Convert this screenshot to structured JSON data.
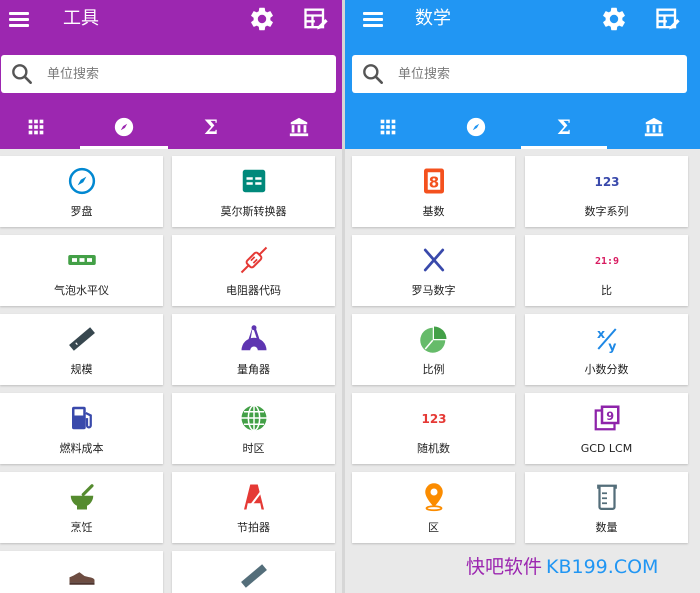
{
  "left": {
    "title": "工具",
    "search_placeholder": "单位搜索",
    "tabs": [
      {
        "icon": "grid-icon",
        "active": false
      },
      {
        "icon": "compass-icon",
        "active": true
      },
      {
        "icon": "sigma-icon",
        "label": "Σ",
        "active": false
      },
      {
        "icon": "bank-icon",
        "active": false
      }
    ],
    "items": [
      {
        "label": "罗盘",
        "icon": "compass-icon",
        "color": "#0288d1"
      },
      {
        "label": "莫尔斯转换器",
        "icon": "morse-icon",
        "color": "#00897b"
      },
      {
        "label": "气泡水平仪",
        "icon": "bubble-level-icon",
        "color": "#43a047"
      },
      {
        "label": "电阻器代码",
        "icon": "resistor-icon",
        "color": "#e53935"
      },
      {
        "label": "规模",
        "icon": "ruler-icon",
        "color": "#37474f"
      },
      {
        "label": "量角器",
        "icon": "protractor-icon",
        "color": "#5e35b1"
      },
      {
        "label": "燃料成本",
        "icon": "fuel-icon",
        "color": "#3949ab"
      },
      {
        "label": "时区",
        "icon": "globe-icon",
        "color": "#43a047"
      },
      {
        "label": "烹饪",
        "icon": "mortar-icon",
        "color": "#558b2f"
      },
      {
        "label": "节拍器",
        "icon": "metronome-icon",
        "color": "#e53935"
      },
      {
        "label": "",
        "icon": "shoe-icon",
        "color": "#6d4c41"
      },
      {
        "label": "",
        "icon": "ruler-icon",
        "color": "#546e7a"
      }
    ]
  },
  "right": {
    "title": "数学",
    "search_placeholder": "单位搜索",
    "tabs": [
      {
        "icon": "grid-icon",
        "active": false
      },
      {
        "icon": "compass-icon",
        "active": false
      },
      {
        "icon": "sigma-icon",
        "label": "Σ",
        "active": true
      },
      {
        "icon": "bank-icon",
        "active": false
      }
    ],
    "items": [
      {
        "label": "基数",
        "icon": "base-8-icon",
        "glyph": "8",
        "color": "#f4511e"
      },
      {
        "label": "数字系列",
        "icon": "number-series-icon",
        "glyph": "123",
        "color": "#3949ab"
      },
      {
        "label": "罗马数字",
        "icon": "roman-x-icon",
        "glyph": "X",
        "color": "#3949ab"
      },
      {
        "label": "比",
        "icon": "ratio-icon",
        "glyph": "21:9",
        "color": "#d81b60"
      },
      {
        "label": "比例",
        "icon": "pie-chart-icon",
        "color": "#43a047"
      },
      {
        "label": "小数分数",
        "icon": "fraction-icon",
        "glyph": "x/y",
        "color": "#1e88e5"
      },
      {
        "label": "随机数",
        "icon": "random-number-icon",
        "glyph": "123",
        "color": "#e53935"
      },
      {
        "label": "GCD LCM",
        "icon": "gcd-icon",
        "glyph": "9",
        "color": "#8e24aa"
      },
      {
        "label": "区",
        "icon": "location-pin-icon",
        "color": "#fb8c00"
      },
      {
        "label": "数量",
        "icon": "beaker-icon",
        "color": "#546e7a"
      }
    ]
  },
  "watermark": {
    "cn": "快吧软件",
    "en": "KB199.COM"
  },
  "colors": {
    "tools_header": "#9c27b0",
    "math_header": "#2196f3"
  }
}
